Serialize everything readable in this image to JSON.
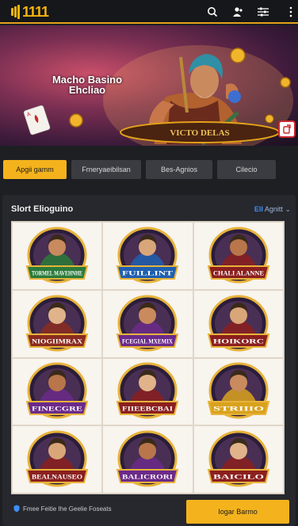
{
  "header": {
    "logo_text": "1111",
    "icons": [
      "search-icon",
      "users-icon",
      "filter-icon",
      "menu-icon"
    ]
  },
  "banner": {
    "title": "Macho Basino Ehcliao",
    "bottom_text": "VICTO DELAS"
  },
  "tabs": [
    {
      "label": "Apgii gamm",
      "active": true
    },
    {
      "label": "Frneryaeibilsan",
      "active": false
    },
    {
      "label": "Bes-Agnios",
      "active": false
    },
    {
      "label": "Cilecio",
      "active": false
    }
  ],
  "section": {
    "title": "Slort Elioguino",
    "sort_prefix": "Ell",
    "sort_label": "Agnitt"
  },
  "games": [
    {
      "label": "TORMEL MAVEHNHE",
      "ribbon": "#2a7a3a",
      "accent": "#e7b33a"
    },
    {
      "label": "FUILLINT",
      "ribbon": "#1f5fb0",
      "accent": "#e7b33a"
    },
    {
      "label": "CHALI ALANNE",
      "ribbon": "#8b1f1f",
      "accent": "#e7b33a"
    },
    {
      "label": "NIOGIIMRAX",
      "ribbon": "#8b2b1f",
      "accent": "#e7b33a"
    },
    {
      "label": "FCEGIAL MXEMIX",
      "ribbon": "#6b2a8a",
      "accent": "#e7b33a"
    },
    {
      "label": "HOIKORC",
      "ribbon": "#8b1f1f",
      "accent": "#e7b33a"
    },
    {
      "label": "FINECGRE",
      "ribbon": "#6b2a8a",
      "accent": "#e7b33a"
    },
    {
      "label": "FIIEEBCBAI",
      "ribbon": "#8b1f1f",
      "accent": "#e7b33a"
    },
    {
      "label": "STRIIIO",
      "ribbon": "#d9a21d",
      "accent": "#e7b33a"
    },
    {
      "label": "BEALNAUSEO",
      "ribbon": "#8b1f1f",
      "accent": "#e7b33a"
    },
    {
      "label": "BALICRORI",
      "ribbon": "#6b2a8a",
      "accent": "#e7b33a"
    },
    {
      "label": "BAICILO",
      "ribbon": "#8b1f1f",
      "accent": "#e7b33a"
    }
  ],
  "footer": {
    "note": "Fmee Feitie Ihe Geelie Foseats",
    "button_label": "Iogar Barmo"
  },
  "colors": {
    "accent": "#f4b31d",
    "header_border": "#e2a21a",
    "background": "#1d1f23"
  }
}
